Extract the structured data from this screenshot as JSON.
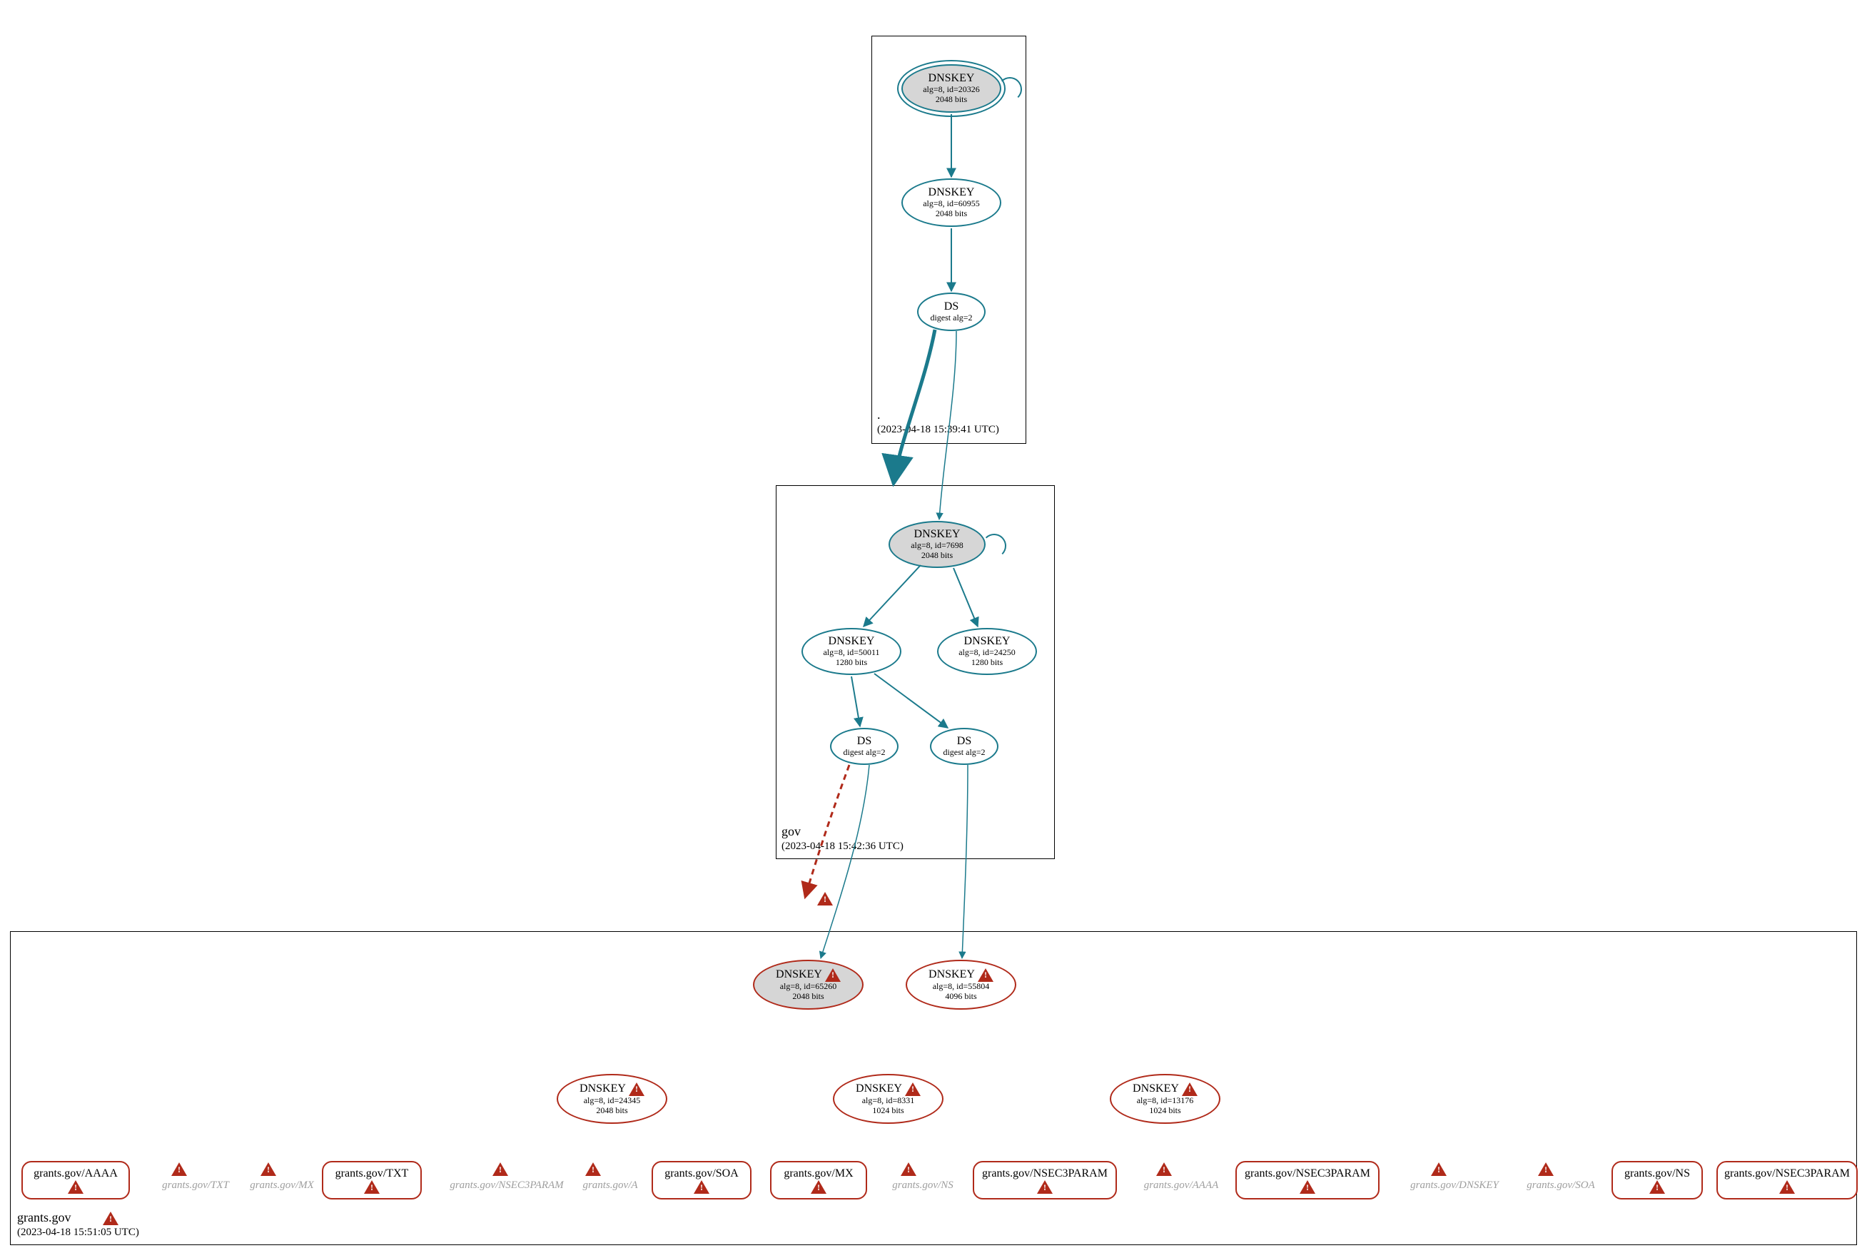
{
  "zones": {
    "root": {
      "label": ".",
      "timestamp": "(2023-04-18 15:39:41 UTC)"
    },
    "gov": {
      "label": "gov",
      "timestamp": "(2023-04-18 15:42:36 UTC)"
    },
    "grants": {
      "label": "grants.gov",
      "timestamp": "(2023-04-18 15:51:05 UTC)"
    }
  },
  "nodes": {
    "root_ksk": {
      "title": "DNSKEY",
      "line1": "alg=8, id=20326",
      "line2": "2048 bits"
    },
    "root_zsk": {
      "title": "DNSKEY",
      "line1": "alg=8, id=60955",
      "line2": "2048 bits"
    },
    "root_ds": {
      "title": "DS",
      "line1": "digest alg=2",
      "line2": ""
    },
    "gov_ksk": {
      "title": "DNSKEY",
      "line1": "alg=8, id=7698",
      "line2": "2048 bits"
    },
    "gov_zsk1": {
      "title": "DNSKEY",
      "line1": "alg=8, id=50011",
      "line2": "1280 bits"
    },
    "gov_zsk2": {
      "title": "DNSKEY",
      "line1": "alg=8, id=24250",
      "line2": "1280 bits"
    },
    "gov_ds1": {
      "title": "DS",
      "line1": "digest alg=2",
      "line2": ""
    },
    "gov_ds2": {
      "title": "DS",
      "line1": "digest alg=2",
      "line2": ""
    },
    "grants_ksk": {
      "title": "DNSKEY",
      "line1": "alg=8, id=65260",
      "line2": "2048 bits"
    },
    "grants_k2": {
      "title": "DNSKEY",
      "line1": "alg=8, id=55804",
      "line2": "4096 bits"
    },
    "grants_k3": {
      "title": "DNSKEY",
      "line1": "alg=8, id=24345",
      "line2": "2048 bits"
    },
    "grants_k4": {
      "title": "DNSKEY",
      "line1": "alg=8, id=8331",
      "line2": "1024 bits"
    },
    "grants_k5": {
      "title": "DNSKEY",
      "line1": "alg=8, id=13176",
      "line2": "1024 bits"
    }
  },
  "rrsets": {
    "r1": "grants.gov/AAAA",
    "r2": "grants.gov/TXT",
    "r3": "grants.gov/SOA",
    "r4": "grants.gov/MX",
    "r5": "grants.gov/NSEC3PARAM",
    "r6": "grants.gov/NSEC3PARAM",
    "r7": "grants.gov/NS",
    "r8": "grants.gov/NSEC3PARAM"
  },
  "ghosts": {
    "g1": "grants.gov/TXT",
    "g2": "grants.gov/MX",
    "g3": "grants.gov/NSEC3PARAM",
    "g4": "grants.gov/A",
    "g5": "grants.gov/NS",
    "g6": "grants.gov/AAAA",
    "g7": "grants.gov/DNSKEY",
    "g8": "grants.gov/SOA"
  }
}
